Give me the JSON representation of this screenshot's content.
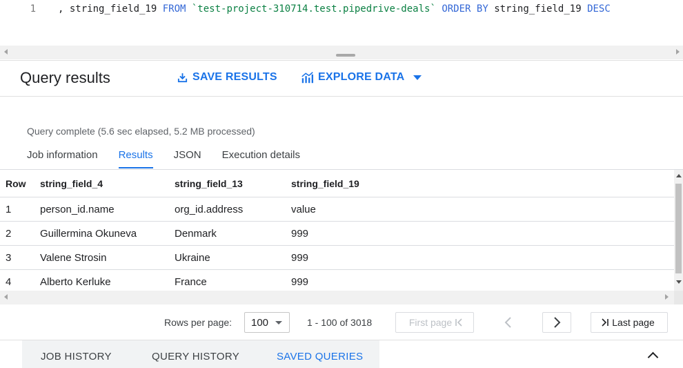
{
  "editor": {
    "line_number": "1",
    "tokens": {
      "t1": ", string_field_19 ",
      "t2": "FROM",
      "t3": " ",
      "t4": "`test-project-310714.test.pipedrive-deals`",
      "t5": " ",
      "t6": "ORDER BY",
      "t7": " string_field_19 ",
      "t8": "DESC"
    }
  },
  "results": {
    "title": "Query results",
    "save_label": "SAVE RESULTS",
    "explore_label": "EXPLORE DATA",
    "status": "Query complete (5.6 sec elapsed, 5.2 MB processed)",
    "tabs": [
      "Job information",
      "Results",
      "JSON",
      "Execution details"
    ],
    "active_tab": "Results"
  },
  "table": {
    "columns": [
      "Row",
      "string_field_4",
      "string_field_13",
      "string_field_19"
    ],
    "rows": [
      [
        "1",
        "person_id.name",
        "org_id.address",
        "value"
      ],
      [
        "2",
        "Guillermina Okuneva",
        "Denmark",
        "999"
      ],
      [
        "3",
        "Valene Strosin",
        "Ukraine",
        "999"
      ],
      [
        "4",
        "Alberto Kerluke",
        "France",
        "999"
      ]
    ]
  },
  "pager": {
    "rows_per_page_label": "Rows per page:",
    "rows_per_page_value": "100",
    "range": "1 - 100 of 3018",
    "first_label": "First page",
    "last_label": "Last page"
  },
  "bottom_tabs": {
    "job_history": "JOB HISTORY",
    "query_history": "QUERY HISTORY",
    "saved_queries": "SAVED QUERIES"
  },
  "colors": {
    "accent": "#1a73e8",
    "keyword": "#3367d6",
    "string": "#0b8043"
  },
  "icons": [
    "save-icon",
    "explore-chart-icon",
    "dropdown-caret-icon",
    "first-page-icon",
    "prev-page-icon",
    "next-page-icon",
    "last-page-icon",
    "chevron-up-icon"
  ]
}
